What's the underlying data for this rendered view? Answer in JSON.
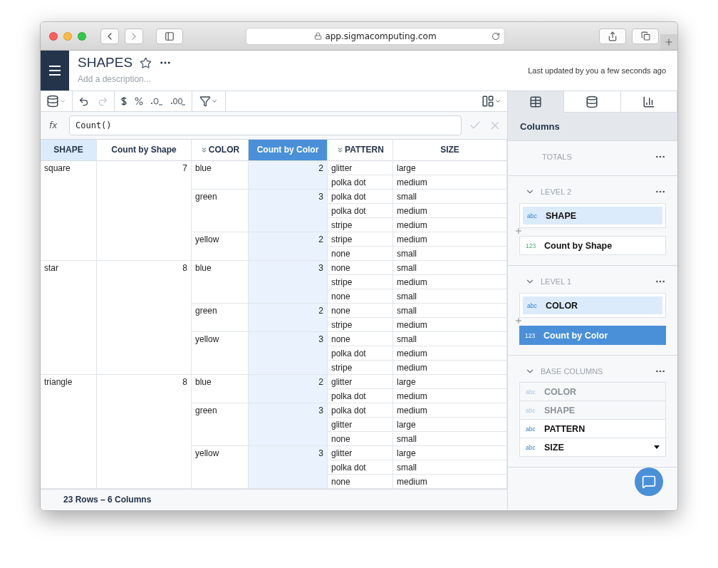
{
  "browser": {
    "url": "app.sigmacomputing.com"
  },
  "header": {
    "title": "SHAPES",
    "description_placeholder": "Add a description...",
    "updated": "Last updated by you a few seconds ago"
  },
  "formula": {
    "label": "fx",
    "value": "Count()"
  },
  "table": {
    "columns": [
      {
        "label": "SHAPE",
        "key": true,
        "selected": false,
        "collapsible": false
      },
      {
        "label": "Count by Shape",
        "key": false,
        "selected": false,
        "collapsible": false
      },
      {
        "label": "COLOR",
        "key": false,
        "selected": false,
        "collapsible": true
      },
      {
        "label": "Count by Color",
        "key": false,
        "selected": true,
        "collapsible": false
      },
      {
        "label": "PATTERN",
        "key": false,
        "selected": false,
        "collapsible": true
      },
      {
        "label": "SIZE",
        "key": false,
        "selected": false,
        "collapsible": false
      }
    ],
    "groups": [
      {
        "shape": "square",
        "count": "7",
        "subgroups": [
          {
            "label": "blue",
            "count": "2",
            "rows": [
              {
                "pattern": "glitter",
                "size": "large"
              },
              {
                "pattern": "polka dot",
                "size": "medium"
              }
            ]
          },
          {
            "label": "green",
            "count": "3",
            "rows": [
              {
                "pattern": "polka dot",
                "size": "small"
              },
              {
                "pattern": "polka dot",
                "size": "medium"
              },
              {
                "pattern": "stripe",
                "size": "medium"
              }
            ]
          },
          {
            "label": "yellow",
            "count": "2",
            "rows": [
              {
                "pattern": "stripe",
                "size": "medium"
              },
              {
                "pattern": "none",
                "size": "small"
              }
            ]
          }
        ]
      },
      {
        "shape": "star",
        "count": "8",
        "subgroups": [
          {
            "label": "blue",
            "count": "3",
            "rows": [
              {
                "pattern": "none",
                "size": "small"
              },
              {
                "pattern": "stripe",
                "size": "medium"
              },
              {
                "pattern": "none",
                "size": "small"
              }
            ]
          },
          {
            "label": "green",
            "count": "2",
            "rows": [
              {
                "pattern": "none",
                "size": "small"
              },
              {
                "pattern": "stripe",
                "size": "medium"
              }
            ]
          },
          {
            "label": "yellow",
            "count": "3",
            "rows": [
              {
                "pattern": "none",
                "size": "small"
              },
              {
                "pattern": "polka dot",
                "size": "medium"
              },
              {
                "pattern": "stripe",
                "size": "medium"
              }
            ]
          }
        ]
      },
      {
        "shape": "triangle",
        "count": "8",
        "subgroups": [
          {
            "label": "blue",
            "count": "2",
            "rows": [
              {
                "pattern": "glitter",
                "size": "large"
              },
              {
                "pattern": "polka dot",
                "size": "medium"
              }
            ]
          },
          {
            "label": "green",
            "count": "3",
            "rows": [
              {
                "pattern": "polka dot",
                "size": "medium"
              },
              {
                "pattern": "glitter",
                "size": "large"
              },
              {
                "pattern": "none",
                "size": "small"
              }
            ]
          },
          {
            "label": "yellow",
            "count": "3",
            "rows": [
              {
                "pattern": "glitter",
                "size": "large"
              },
              {
                "pattern": "polka dot",
                "size": "small"
              },
              {
                "pattern": "none",
                "size": "medium"
              }
            ]
          }
        ]
      }
    ],
    "footer": "23 Rows – 6 Columns"
  },
  "panel": {
    "tabs": [
      {
        "kind": "table",
        "selected": true
      },
      {
        "kind": "data",
        "selected": false
      },
      {
        "kind": "chart",
        "selected": false
      }
    ],
    "title": "Columns",
    "sections": [
      {
        "label": "TOTALS",
        "collapsible": false
      },
      {
        "label": "LEVEL 2",
        "collapsible": true,
        "items": [
          {
            "type": "abc",
            "name": "SHAPE",
            "kind": "key",
            "selected": false,
            "dimmed": false,
            "dropdown": false
          },
          {
            "type": "123",
            "name": "Count by Shape",
            "kind": "measure",
            "selected": false,
            "dimmed": false,
            "dropdown": false
          }
        ]
      },
      {
        "label": "LEVEL 1",
        "collapsible": true,
        "items": [
          {
            "type": "abc",
            "name": "COLOR",
            "kind": "key",
            "selected": false,
            "dimmed": false,
            "dropdown": false
          },
          {
            "type": "123",
            "name": "Count by Color",
            "kind": "measure",
            "selected": true,
            "dimmed": false,
            "dropdown": false
          }
        ]
      },
      {
        "label": "BASE COLUMNS",
        "collapsible": true,
        "items": [
          {
            "type": "abc",
            "name": "COLOR",
            "kind": "base",
            "selected": false,
            "dimmed": true,
            "dropdown": false
          },
          {
            "type": "abc",
            "name": "SHAPE",
            "kind": "base",
            "selected": false,
            "dimmed": true,
            "dropdown": false
          },
          {
            "type": "abc",
            "name": "PATTERN",
            "kind": "base",
            "selected": false,
            "dimmed": false,
            "dropdown": false
          },
          {
            "type": "abc",
            "name": "SIZE",
            "kind": "base",
            "selected": false,
            "dimmed": false,
            "dropdown": true
          }
        ]
      }
    ]
  }
}
